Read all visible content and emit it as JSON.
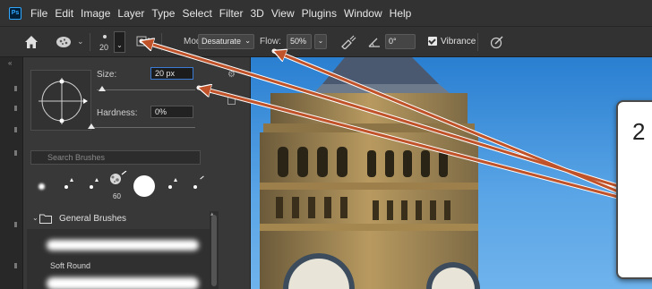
{
  "app": {
    "logo_text": "Ps",
    "menu": [
      "File",
      "Edit",
      "Image",
      "Layer",
      "Type",
      "Select",
      "Filter",
      "3D",
      "View",
      "Plugins",
      "Window",
      "Help"
    ]
  },
  "options_bar": {
    "brush_size": "20",
    "mode_label": "Mode:",
    "mode_value": "Desaturate",
    "flow_label": "Flow:",
    "flow_value": "50%",
    "angle_value": "0°",
    "vibrance_label": "Vibrance",
    "vibrance_checked": true
  },
  "brush_panel": {
    "size_label": "Size:",
    "size_value": "20 px",
    "size_slider_percent": 5,
    "hardness_label": "Hardness:",
    "hardness_value": "0%",
    "hardness_slider_percent": 0,
    "search_placeholder": "Search Brushes",
    "recent_brushes": [
      {
        "kind": "soft",
        "label": ""
      },
      {
        "kind": "hard-small",
        "label": ""
      },
      {
        "kind": "hard-small",
        "label": ""
      },
      {
        "kind": "textured",
        "label": "60"
      },
      {
        "kind": "hard-large",
        "label": ""
      },
      {
        "kind": "hard-small",
        "label": ""
      },
      {
        "kind": "hard-small",
        "label": ""
      }
    ],
    "folder_label": "General Brushes",
    "brushes": [
      {
        "name": "Soft Round"
      }
    ]
  },
  "callout": {
    "text": "2"
  },
  "colors": {
    "accent_blue": "#3a7bd5",
    "arrow_orange": "#c0532a"
  }
}
